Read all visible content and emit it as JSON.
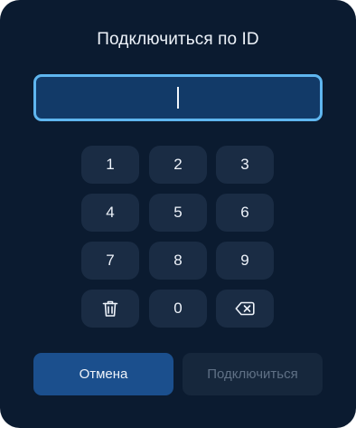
{
  "dialog": {
    "title": "Подключиться по ID"
  },
  "id_input": {
    "value": "",
    "placeholder": ""
  },
  "keypad": {
    "keys": [
      "1",
      "2",
      "3",
      "4",
      "5",
      "6",
      "7",
      "8",
      "9",
      "0"
    ],
    "clear_icon": "trash-icon",
    "backspace_icon": "backspace-icon"
  },
  "actions": {
    "cancel_label": "Отмена",
    "connect_label": "Подключиться"
  },
  "colors": {
    "background": "#0b1b30",
    "input_fill": "#123a68",
    "input_border": "#5fb6ef",
    "key_fill": "#1a2c44",
    "cancel_fill": "#1b4f8d",
    "connect_disabled_fill": "#16273c",
    "connect_disabled_text": "#5f7085"
  }
}
